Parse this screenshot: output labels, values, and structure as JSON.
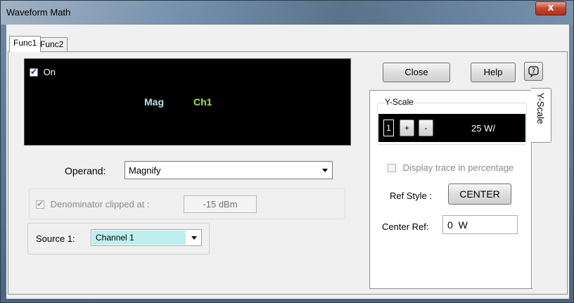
{
  "window": {
    "title": "Waveform Math",
    "close_glyph": "x"
  },
  "tabs": [
    {
      "label": "Func1",
      "active": true
    },
    {
      "label": "Func2",
      "active": false
    }
  ],
  "display": {
    "on_label": "On",
    "on_checked": true,
    "function_label": "Mag",
    "channel_label": "Ch1",
    "function_color": "#b8e6ea",
    "channel_color": "#9fe84a"
  },
  "operand": {
    "label": "Operand:",
    "value": "Magnify"
  },
  "denominator": {
    "label": "Denominator clipped at :",
    "value": "-15 dBm",
    "checked": true,
    "enabled": false
  },
  "source": {
    "label": "Source 1:",
    "value": "Channel 1",
    "highlight_color": "#bfeeee"
  },
  "buttons": {
    "close": "Close",
    "help": "Help",
    "context_help_icon": "question-bubble-icon"
  },
  "yscale": {
    "side_tab": "Y-Scale",
    "group_label": "Y-Scale",
    "channel_badge": "1",
    "plus": "+",
    "minus": "-",
    "scale_value": "25 W/",
    "display_percentage_label": "Display trace in percentage",
    "ref_style_label": "Ref Style :",
    "ref_style_value": "CENTER",
    "center_ref_label": "Center Ref:",
    "center_ref_value": "0  W"
  }
}
